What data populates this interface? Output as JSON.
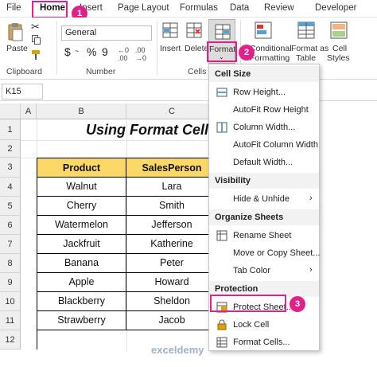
{
  "tabs": [
    "File",
    "Home",
    "Insert",
    "Page Layout",
    "Formulas",
    "Data",
    "Review",
    "Developer"
  ],
  "ribbon": {
    "paste": "Paste",
    "clipboard": "Clipboard",
    "number_format": "General",
    "number_symbols": [
      "$",
      "~",
      "%",
      "9"
    ],
    "number": "Number",
    "insert": "Insert",
    "delete": "Delete",
    "format": "Format",
    "cells": "Cells",
    "conditional_formatting_1": "Conditional",
    "conditional_formatting_2": "Formatting",
    "format_as_table_1": "Format as",
    "format_as_table_2": "Table",
    "cell_styles_1": "Cell",
    "cell_styles_2": "Styles"
  },
  "formula_bar": {
    "name_box": "K15",
    "fx": "fx"
  },
  "columns": [
    "A",
    "B",
    "C"
  ],
  "rows": [
    "1",
    "2",
    "3",
    "4",
    "5",
    "6",
    "7",
    "8",
    "9",
    "10",
    "11",
    "12"
  ],
  "sheet": {
    "title": "Using Format Cells",
    "headers": [
      "Product",
      "SalesPerson"
    ],
    "data": [
      [
        "Walnut",
        "Lara"
      ],
      [
        "Cherry",
        "Smith"
      ],
      [
        "Watermelon",
        "Jefferson"
      ],
      [
        "Jackfruit",
        "Katherine"
      ],
      [
        "Banana",
        "Peter"
      ],
      [
        "Apple",
        "Howard"
      ],
      [
        "Blackberry",
        "Sheldon"
      ],
      [
        "Strawberry",
        "Jacob"
      ]
    ]
  },
  "menu": {
    "sec_cell_size": "Cell Size",
    "row_height": "Row Height...",
    "autofit_row": "AutoFit Row Height",
    "column_width": "Column Width...",
    "autofit_column": "AutoFit Column Width",
    "default_width": "Default Width...",
    "sec_visibility": "Visibility",
    "hide_unhide": "Hide & Unhide",
    "sec_organize": "Organize Sheets",
    "rename_sheet": "Rename Sheet",
    "move_copy": "Move or Copy Sheet...",
    "tab_color": "Tab Color",
    "sec_protection": "Protection",
    "protect_sheet": "Protect Sheet...",
    "lock_cell": "Lock Cell",
    "format_cells": "Format Cells..."
  },
  "badges": [
    "1",
    "2",
    "3"
  ],
  "watermark": "exceldemy",
  "colors": {
    "accent": "#e0218a",
    "header_fill": "#fbd768"
  }
}
